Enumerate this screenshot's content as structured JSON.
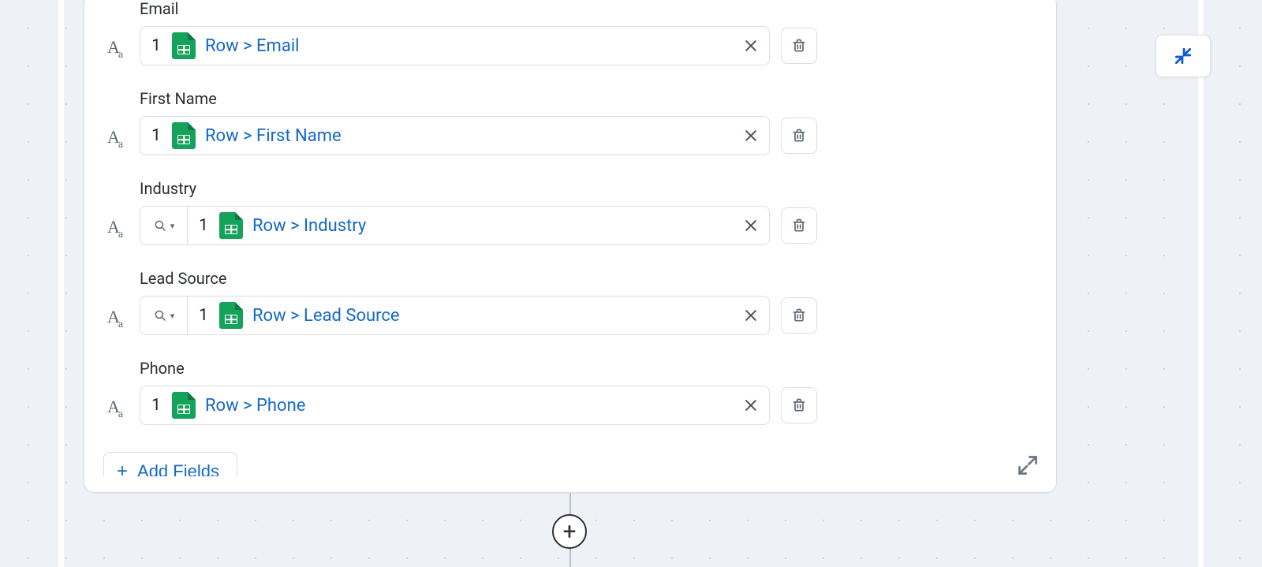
{
  "fields": [
    {
      "label": "Email",
      "hasLookup": false,
      "order": "1",
      "value": "Row > Email"
    },
    {
      "label": "First Name",
      "hasLookup": false,
      "order": "1",
      "value": "Row > First Name"
    },
    {
      "label": "Industry",
      "hasLookup": true,
      "order": "1",
      "value": "Row > Industry"
    },
    {
      "label": "Lead Source",
      "hasLookup": true,
      "order": "1",
      "value": "Row > Lead Source"
    },
    {
      "label": "Phone",
      "hasLookup": false,
      "order": "1",
      "value": "Row > Phone"
    }
  ],
  "addFieldsLabel": "Add Fields"
}
